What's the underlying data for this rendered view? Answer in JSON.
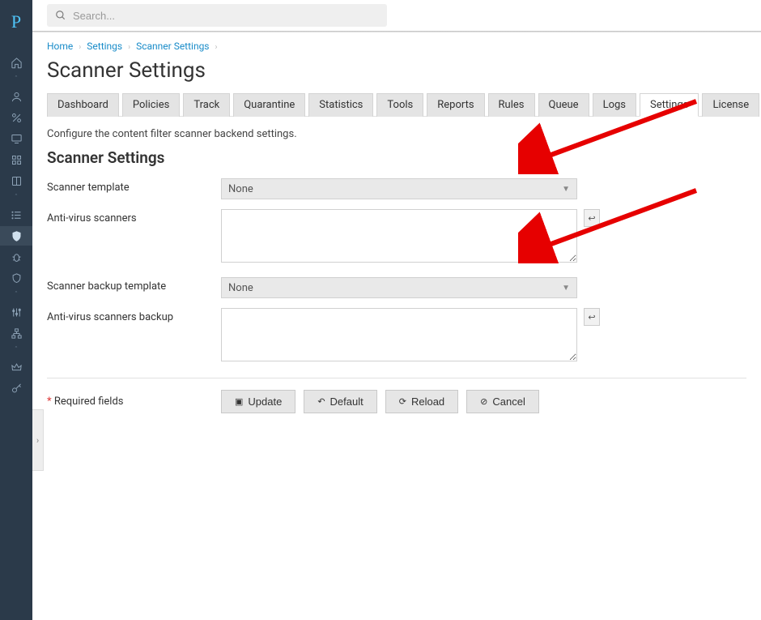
{
  "logo": "P",
  "search": {
    "placeholder": "Search..."
  },
  "breadcrumb": {
    "home": "Home",
    "settings": "Settings",
    "scanner": "Scanner Settings"
  },
  "page_title": "Scanner Settings",
  "tabs": [
    "Dashboard",
    "Policies",
    "Track",
    "Quarantine",
    "Statistics",
    "Tools",
    "Reports",
    "Rules",
    "Queue",
    "Logs",
    "Settings",
    "License"
  ],
  "active_tab": "Settings",
  "description": "Configure the content filter scanner backend settings.",
  "section_title": "Scanner Settings",
  "fields": {
    "scanner_template": {
      "label": "Scanner template",
      "value": "None"
    },
    "antivirus": {
      "label": "Anti-virus scanners",
      "value": ""
    },
    "backup_template": {
      "label": "Scanner backup template",
      "value": "None"
    },
    "antivirus_backup": {
      "label": "Anti-virus scanners backup",
      "value": ""
    }
  },
  "required_label": "Required fields",
  "buttons": {
    "update": "Update",
    "default": "Default",
    "reload": "Reload",
    "cancel": "Cancel"
  }
}
